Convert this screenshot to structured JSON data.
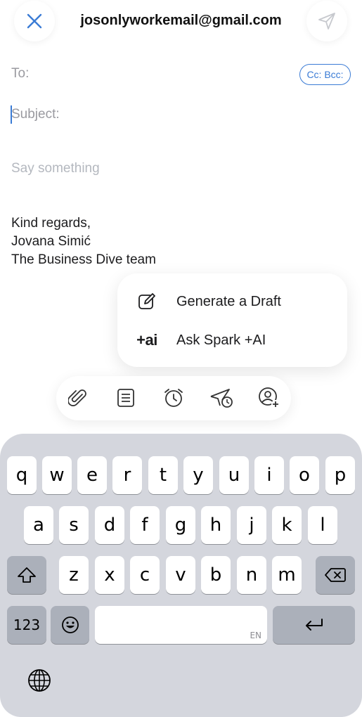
{
  "header": {
    "from_account": "josonlyworkemail@gmail.com"
  },
  "fields": {
    "to_label": "To:",
    "ccbcc_label": "Cc: Bcc:",
    "subject_placeholder": "Subject:",
    "body_placeholder": "Say something"
  },
  "signature": [
    "Kind regards,",
    "Jovana Simić",
    "The Business Dive team"
  ],
  "ai_menu": {
    "items": [
      {
        "icon": "edit-draft-icon",
        "label": "Generate a Draft"
      },
      {
        "icon": "ai-logo",
        "logo_text": "+ai",
        "label": "Ask Spark +AI"
      }
    ]
  },
  "toolbar": {
    "icons": [
      "paperclip-icon",
      "template-icon",
      "reminder-alarm-icon",
      "send-later-icon",
      "add-person-icon"
    ]
  },
  "keyboard": {
    "row1": [
      "q",
      "w",
      "e",
      "r",
      "t",
      "y",
      "u",
      "i",
      "o",
      "p"
    ],
    "row2": [
      "a",
      "s",
      "d",
      "f",
      "g",
      "h",
      "j",
      "k",
      "l"
    ],
    "row3": [
      "z",
      "x",
      "c",
      "v",
      "b",
      "n",
      "m"
    ],
    "numbers_key": "123",
    "space_lang": "EN"
  },
  "colors": {
    "accent": "#3a7bd5",
    "keyboard_bg": "#d4d6dd",
    "placeholder": "#9a9aa0"
  }
}
